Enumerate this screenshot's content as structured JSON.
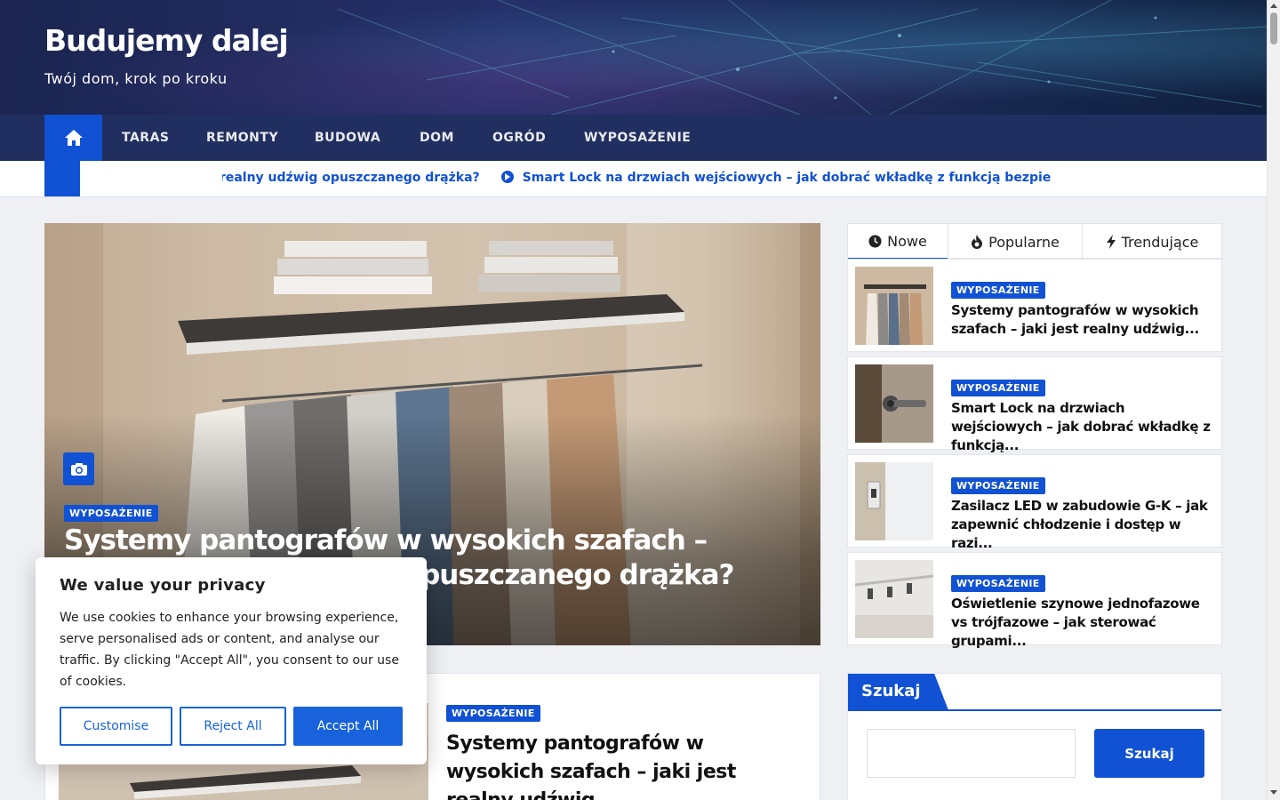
{
  "site": {
    "title": "Budujemy dalej",
    "tagline": "Twój dom, krok po kroku"
  },
  "nav": {
    "home_icon": "home-icon",
    "items": [
      "TARAS",
      "REMONTY",
      "BUDOWA",
      "DOM",
      "OGRÓD",
      "WYPOSAŻENIE"
    ]
  },
  "ticker": {
    "items": [
      "Systemy pantografów w wysokich szafach – jaki jest realny udźwig opuszczanego drążka?",
      "Smart Lock na drzwiach wejściowych – jak dobrać wkładkę z funkcją bezpie"
    ]
  },
  "hero": {
    "category": "WYPOSAŻENIE",
    "title": "Systemy pantografów w wysokich szafach – jaki jest realny udźwig opuszczanego drążka?",
    "icon": "camera-icon"
  },
  "post": {
    "category": "WYPOSAŻENIE",
    "title": "Systemy pantografów w wysokich szafach – jaki jest realny udźwig..."
  },
  "sidebar": {
    "tabs": [
      {
        "label": "Nowe",
        "icon": "clock-icon"
      },
      {
        "label": "Popularne",
        "icon": "fire-icon"
      },
      {
        "label": "Trendujące",
        "icon": "bolt-icon"
      }
    ],
    "items": [
      {
        "category": "WYPOSAŻENIE",
        "title": "Systemy pantografów w wysokich szafach – jaki jest realny udźwig..."
      },
      {
        "category": "WYPOSAŻENIE",
        "title": "Smart Lock na drzwiach wejściowych – jak dobrać wkładkę z funkcją..."
      },
      {
        "category": "WYPOSAŻENIE",
        "title": "Zasilacz LED w zabudowie G-K – jak zapewnić chłodzenie i dostęp w razi..."
      },
      {
        "category": "WYPOSAŻENIE",
        "title": "Oświetlenie szynowe jednofazowe vs trójfazowe – jak sterować grupami..."
      }
    ]
  },
  "search": {
    "heading": "Szukaj",
    "placeholder": "",
    "button": "Szukaj"
  },
  "cookie": {
    "title": "We value your privacy",
    "text": "We use cookies to enhance your browsing experience, serve personalised ads or content, and analyse our traffic. By clicking \"Accept All\", you consent to our use of cookies.",
    "customise": "Customise",
    "reject": "Reject All",
    "accept": "Accept All"
  },
  "colors": {
    "accent": "#1151d3",
    "nav_bg": "#202f5f",
    "cookie_accent": "#1863dc"
  }
}
